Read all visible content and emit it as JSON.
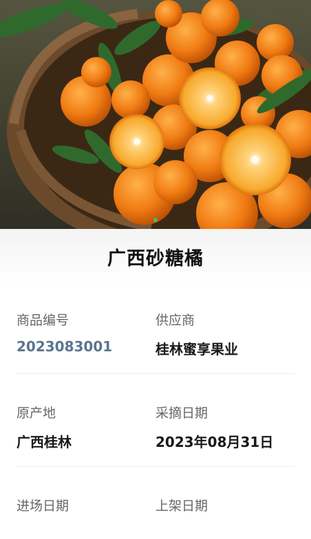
{
  "product": {
    "name": "广西砂糖橘",
    "image_alt": "mandarin-oranges-basket-photo"
  },
  "carousel": {
    "count": 1,
    "active": 0
  },
  "fields": [
    {
      "label": "商品编号",
      "value": "2023083001"
    },
    {
      "label": "供应商",
      "value": "桂林蜜享果业"
    },
    {
      "label": "原产地",
      "value": "广西桂林"
    },
    {
      "label": "采摘日期",
      "value": "2023年08月31日"
    },
    {
      "label": "进场日期",
      "value": ""
    },
    {
      "label": "上架日期",
      "value": ""
    }
  ],
  "colors": {
    "accent": "#3fbf6a",
    "code": "#5a7590",
    "orange": "#f07a12"
  }
}
